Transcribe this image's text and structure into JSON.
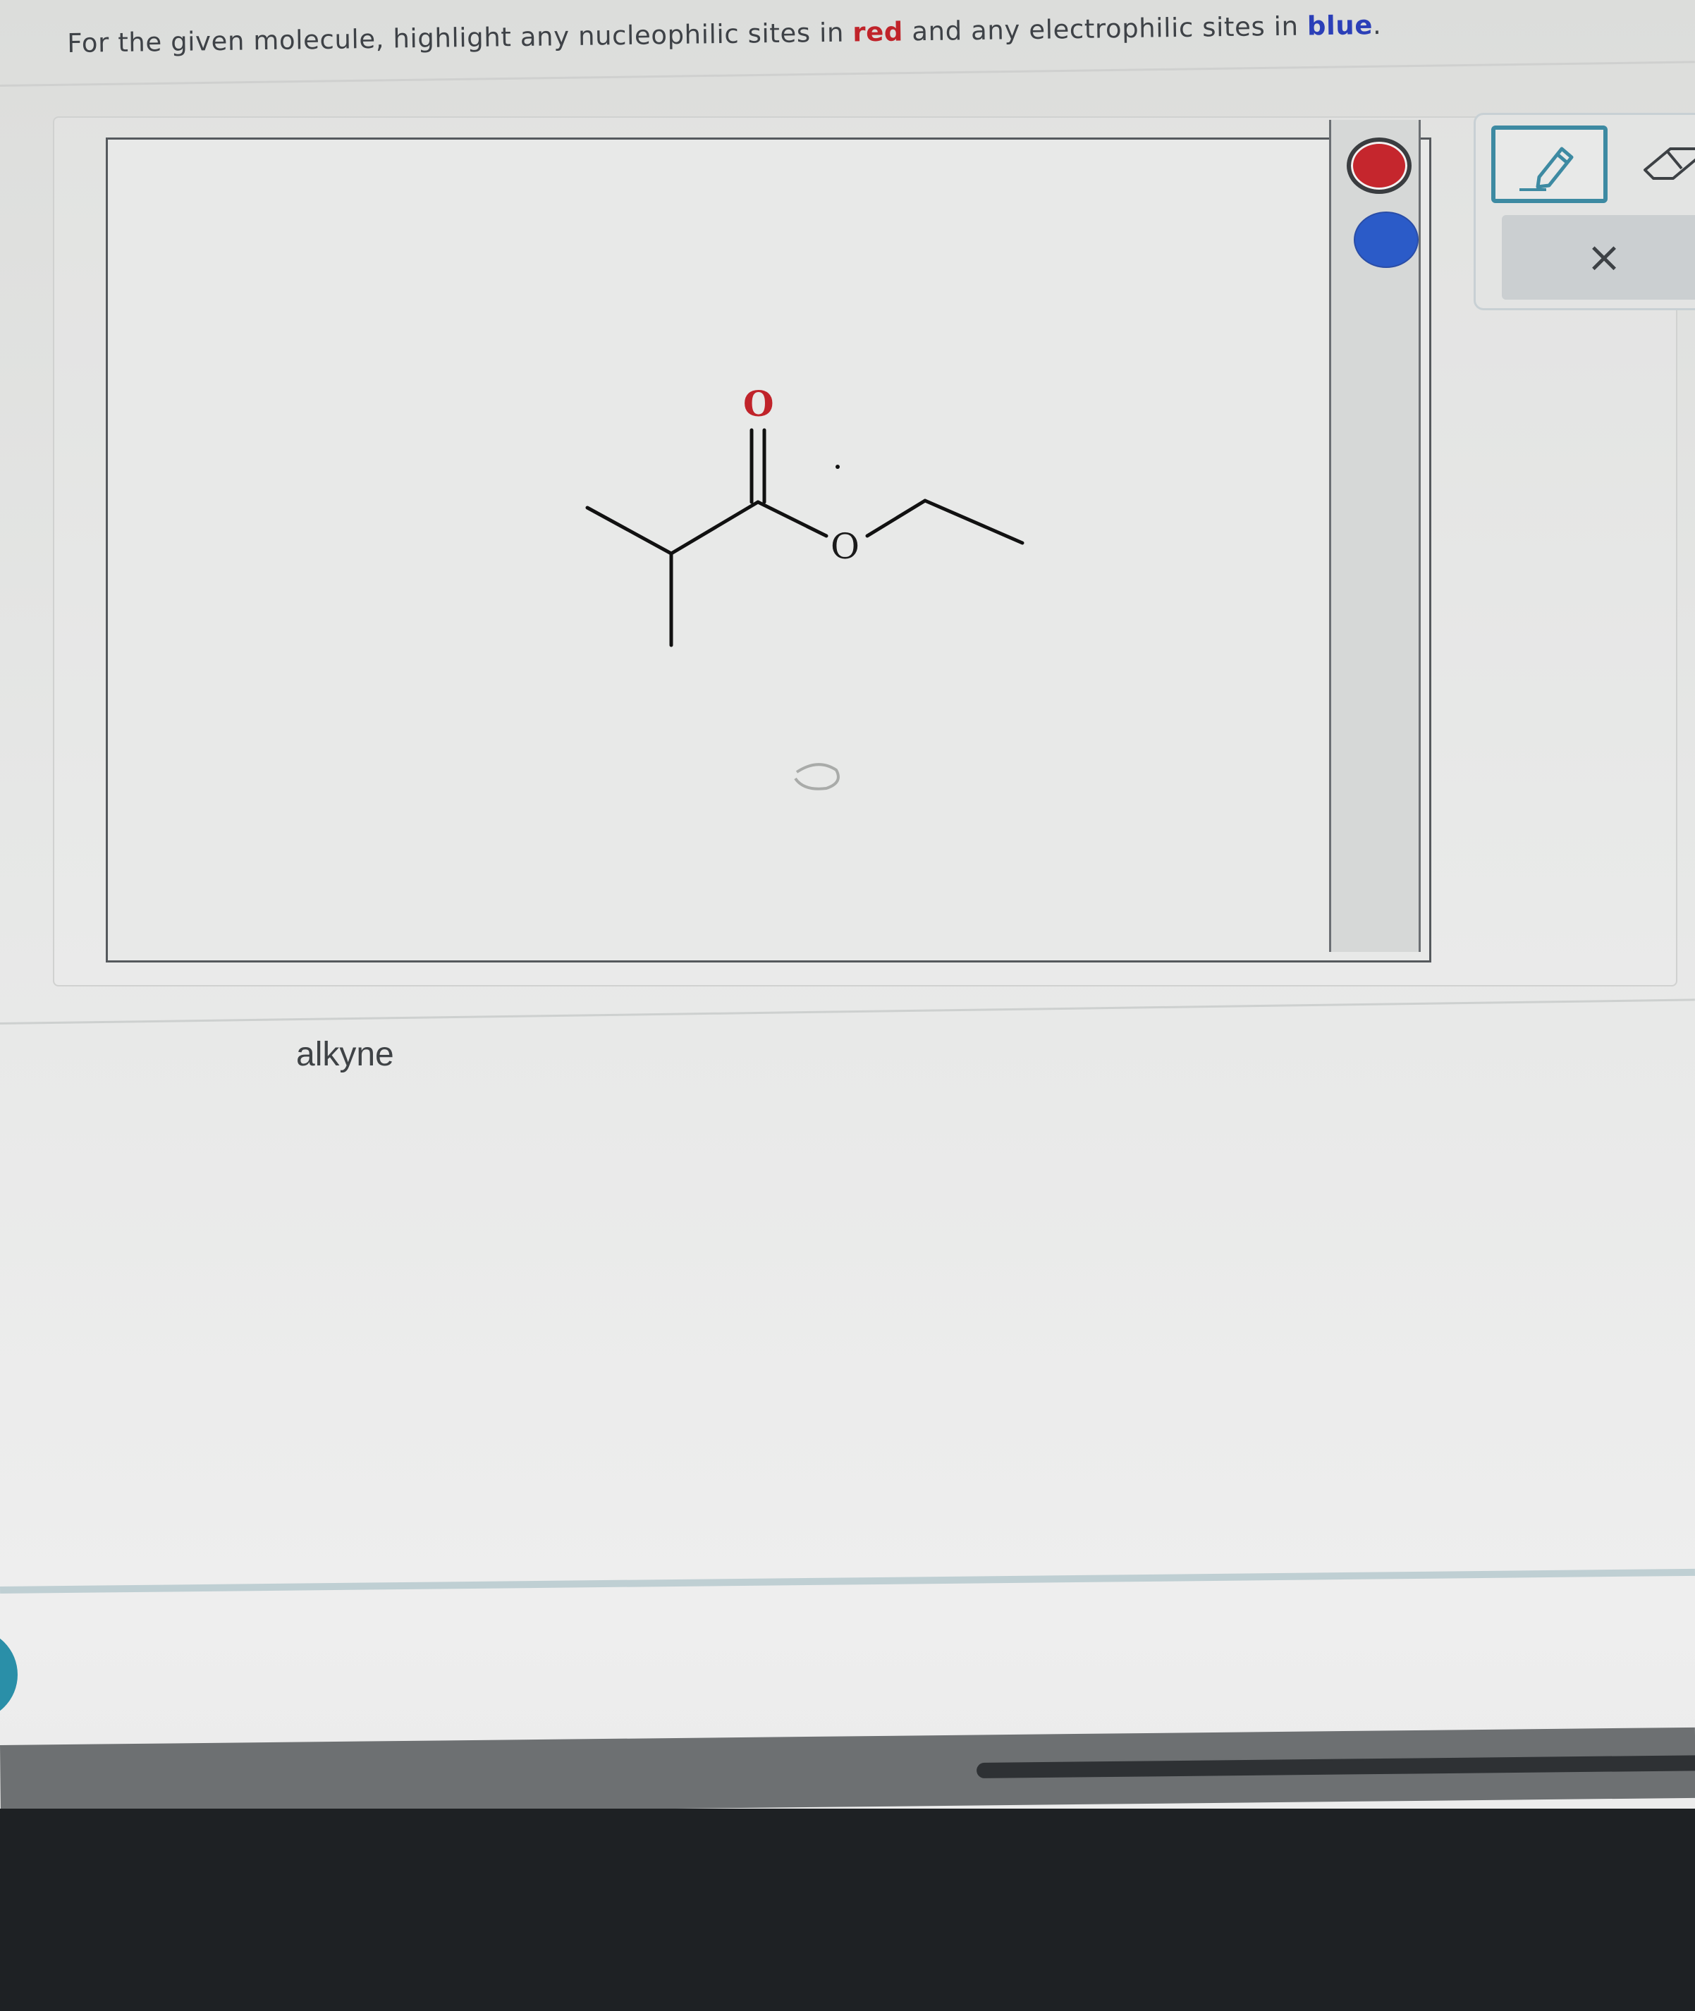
{
  "question": {
    "text_before": "For the given molecule, highlight any nucleophilic sites in ",
    "red_word": "red",
    "text_middle": " and any electrophilic sites in ",
    "blue_word": "blue",
    "text_after": "."
  },
  "colors": {
    "red": "#c5262d",
    "blue": "#2b5bc8",
    "accent": "#3d8aa2"
  },
  "tools": {
    "pencil_icon": "pencil-icon",
    "eraser_icon": "eraser-icon",
    "close_icon": "close-icon",
    "close_glyph": "×"
  },
  "molecule": {
    "carbonyl_oxygen": "O",
    "ester_oxygen": "O"
  },
  "answer": {
    "label": "alkyne"
  }
}
